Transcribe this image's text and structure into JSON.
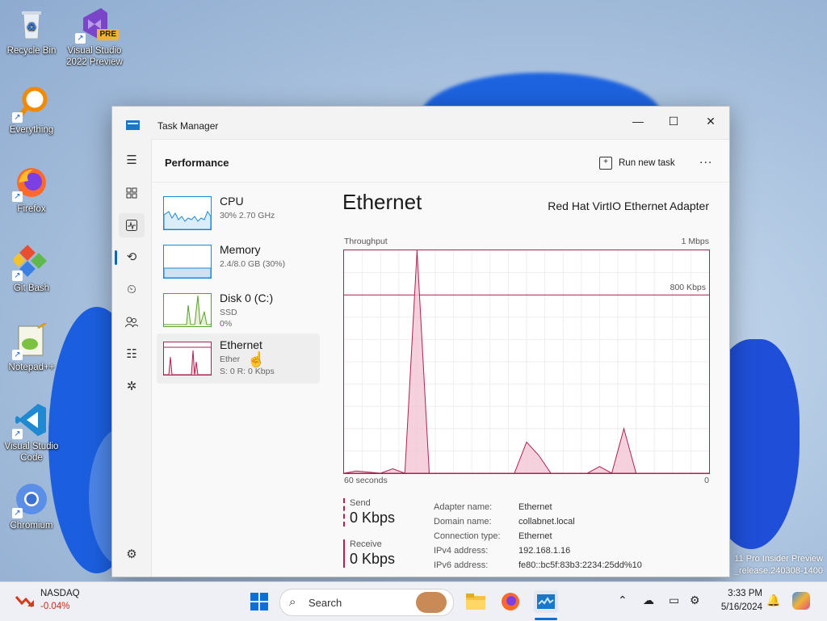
{
  "desktop": {
    "icons": [
      {
        "label": "Recycle Bin"
      },
      {
        "label": "Visual Studio 2022 Preview",
        "badge": "PRE"
      },
      {
        "label": "Everything"
      },
      {
        "label": "Firefox"
      },
      {
        "label": "Git Bash"
      },
      {
        "label": "Notepad++"
      },
      {
        "label": "Visual Studio Code"
      },
      {
        "label": "Chromium"
      }
    ],
    "watermark": {
      "line1": "11 Pro Insider Preview",
      "line2": "_release.240308-1400"
    }
  },
  "window": {
    "title": "Task Manager",
    "controls": {
      "minimize": "—",
      "maximize": "☐",
      "close": "✕"
    }
  },
  "header": {
    "page_title": "Performance",
    "run_new_task": "Run new task",
    "more": "..."
  },
  "perf_list": [
    {
      "name": "CPU",
      "sub1": "30% 2.70 GHz",
      "sub2": ""
    },
    {
      "name": "Memory",
      "sub1": "2.4/8.0 GB (30%)",
      "sub2": ""
    },
    {
      "name": "Disk 0 (C:)",
      "sub1": "SSD",
      "sub2": "0%"
    },
    {
      "name": "Ethernet",
      "sub1": "Ether",
      "sub2": "S: 0 R: 0 Kbps"
    }
  ],
  "detail": {
    "title": "Ethernet",
    "adapter": "Red Hat VirtIO Ethernet Adapter",
    "throughput_label": "Throughput",
    "max_label": "1 Mbps",
    "line_label": "800 Kbps",
    "time_label": "60 seconds",
    "zero_label": "0",
    "send_label": "Send",
    "send_value": "0 Kbps",
    "receive_label": "Receive",
    "receive_value": "0 Kbps",
    "info": [
      {
        "key": "Adapter name:",
        "value": "Ethernet"
      },
      {
        "key": "Domain name:",
        "value": "collabnet.local"
      },
      {
        "key": "Connection type:",
        "value": "Ethernet"
      },
      {
        "key": "IPv4 address:",
        "value": "192.168.1.16"
      },
      {
        "key": "IPv6 address:",
        "value": "fe80::bc5f:83b3:2234:25dd%10"
      }
    ]
  },
  "chart_data": {
    "type": "area",
    "x": [
      0,
      2,
      4,
      6,
      8,
      10,
      12,
      14,
      16,
      18,
      20,
      22,
      24,
      26,
      28,
      30,
      32,
      34,
      36,
      38,
      40,
      42,
      44,
      46,
      48,
      50,
      52,
      54,
      56,
      58,
      60
    ],
    "series": [
      {
        "values": [
          0,
          10,
          5,
          0,
          20,
          0,
          1000,
          0,
          0,
          0,
          0,
          0,
          0,
          0,
          0,
          140,
          80,
          0,
          0,
          0,
          0,
          30,
          0,
          200,
          0,
          0,
          0,
          0,
          0,
          0,
          0
        ]
      },
      {
        "values": [
          0,
          0,
          0,
          0,
          0,
          0,
          0,
          0,
          0,
          0,
          0,
          0,
          0,
          0,
          0,
          0,
          0,
          0,
          0,
          0,
          0,
          0,
          0,
          0,
          0,
          0,
          0,
          0,
          0,
          0,
          0
        ]
      }
    ],
    "ylim": [
      0,
      1000
    ],
    "xlim": [
      0,
      60
    ],
    "grid": true,
    "accent": "#a8244e"
  },
  "taskbar": {
    "stock": {
      "name": "NASDAQ",
      "change": "-0.04%"
    },
    "search": "Search",
    "time": "3:33 PM",
    "date": "5/16/2024"
  }
}
